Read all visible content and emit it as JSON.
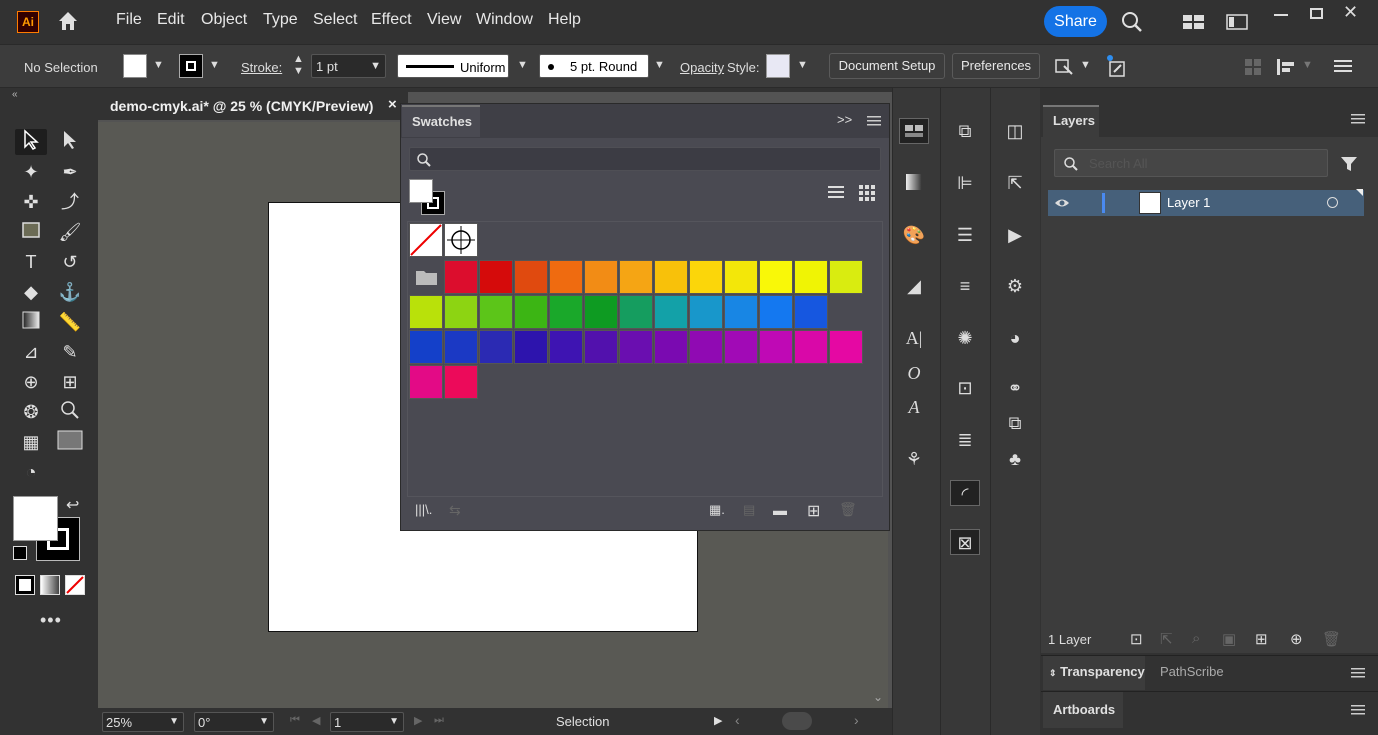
{
  "app": {
    "logo": "Ai"
  },
  "menu": [
    "File",
    "Edit",
    "Object",
    "Type",
    "Select",
    "Effect",
    "View",
    "Window",
    "Help"
  ],
  "share_label": "Share",
  "control": {
    "selection": "No Selection",
    "stroke_label": "Stroke:",
    "stroke_value": "1 pt",
    "profile": "Uniform",
    "brush": "5 pt. Round",
    "opacity_label": "Opacity",
    "style_label": "Style:",
    "document_setup": "Document Setup",
    "preferences": "Preferences"
  },
  "document": {
    "tab_title": "demo-cmyk.ai* @ 25 % (CMYK/Preview)",
    "close": "×"
  },
  "status": {
    "zoom": "25%",
    "rotation": "0°",
    "artboard": "1",
    "tool": "Selection"
  },
  "swatches": {
    "title": "Swatches",
    "colors": [
      [
        "#dc0d2d",
        "#d50b0b",
        "#e04a0f",
        "#ef6b10",
        "#f28c15",
        "#f5a514",
        "#f8c10a",
        "#fbd60a",
        "#f3e709",
        "#f9f808",
        "#f0f404",
        "#d9ec10"
      ],
      [
        "#b9e10a",
        "#8dd412",
        "#5cc519",
        "#3cb514",
        "#1aa82a",
        "#0e9b22",
        "#159d5f",
        "#13a1a8",
        "#1897cb",
        "#1886e4",
        "#1478f0",
        "#1657e0"
      ],
      [
        "#1440c9",
        "#1b39c4",
        "#2b2ab3",
        "#2d14ad",
        "#3e14b2",
        "#5211ad",
        "#6a0eb0",
        "#7a0ab1",
        "#900ab3",
        "#a10ab6",
        "#bf09b5",
        "#d908a8",
        "#e508a3"
      ],
      [
        "#e30a86",
        "#ec0a5a"
      ]
    ]
  },
  "layers": {
    "title": "Layers",
    "search_placeholder": "Search All",
    "items": [
      {
        "name": "Layer 1"
      }
    ],
    "count": "1 Layer"
  },
  "bottom_panels": {
    "transparency": "Transparency",
    "pathscribe": "PathScribe",
    "artboards": "Artboards"
  }
}
